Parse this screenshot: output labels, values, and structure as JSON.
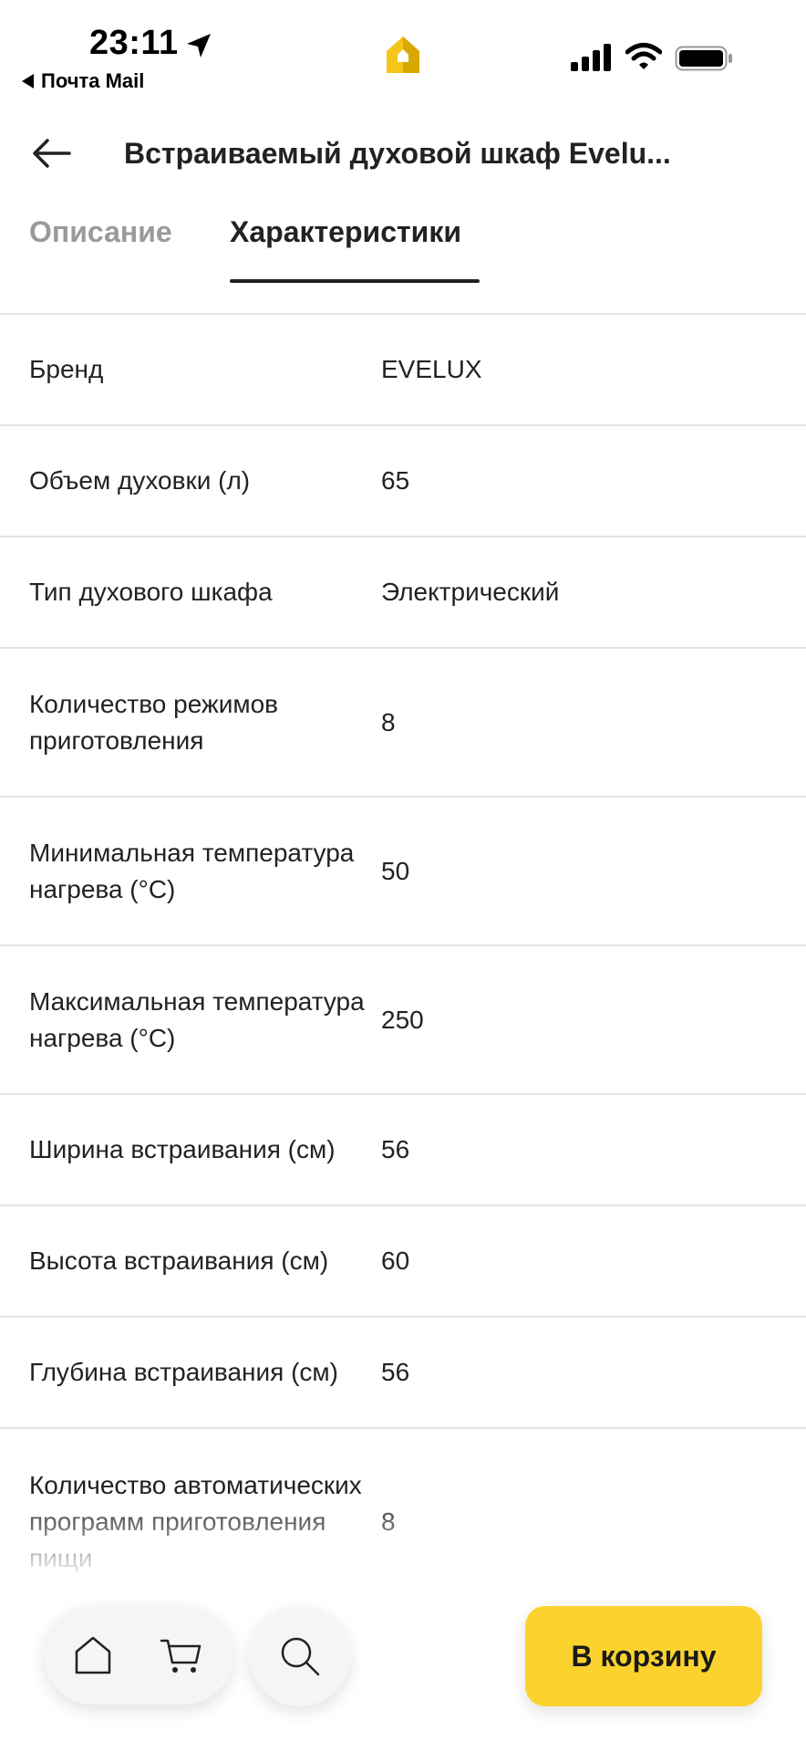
{
  "status_bar": {
    "time": "23:11",
    "back_app": "Почта Mail",
    "icons": [
      "location-arrow-icon",
      "app-logo-icon",
      "signal-icon",
      "wifi-icon",
      "battery-icon"
    ]
  },
  "header": {
    "title": "Встраиваемый духовой шкаф Evelu..."
  },
  "tabs": [
    {
      "label": "Описание",
      "active": false
    },
    {
      "label": "Характеристики",
      "active": true
    }
  ],
  "specs": [
    {
      "label": "Бренд",
      "value": "EVELUX"
    },
    {
      "label": "Объем духовки (л)",
      "value": "65"
    },
    {
      "label": "Тип духового шкафа",
      "value": "Электрический"
    },
    {
      "label": "Количество режимов приготовления",
      "value": "8"
    },
    {
      "label": "Минимальная температура нагрева (°C)",
      "value": "50"
    },
    {
      "label": "Максимальная температура нагрева (°C)",
      "value": "250"
    },
    {
      "label": "Ширина встраивания (см)",
      "value": "56"
    },
    {
      "label": "Высота встраивания (см)",
      "value": "60"
    },
    {
      "label": "Глубина встраивания (см)",
      "value": "56"
    },
    {
      "label": "Количество автоматических программ приготовления пищи",
      "value": "8"
    }
  ],
  "bottom_bar": {
    "add_to_cart_label": "В корзину",
    "icons": [
      "home-icon",
      "cart-icon",
      "search-icon"
    ]
  },
  "colors": {
    "accent": "#fcd22e",
    "text": "#222222",
    "muted": "#9a9a9a",
    "divider": "#e6e4df"
  }
}
